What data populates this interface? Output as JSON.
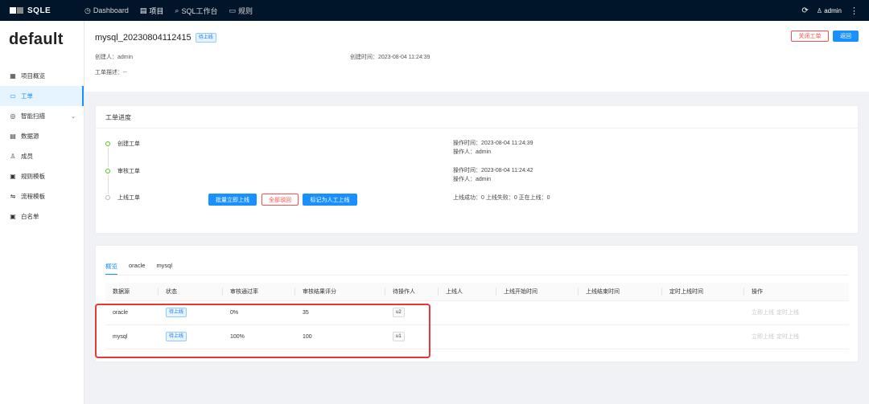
{
  "topbar": {
    "brand": "SQLE",
    "nav": [
      {
        "label": "Dashboard",
        "icon": "dashboard-icon",
        "glyph": "◷"
      },
      {
        "label": "项目",
        "icon": "project-icon",
        "glyph": "▤"
      },
      {
        "label": "SQL工作台",
        "icon": "search-icon",
        "glyph": "⌕"
      },
      {
        "label": "规则",
        "icon": "monitor-icon",
        "glyph": "▭"
      }
    ],
    "user": "admin"
  },
  "sidebar": {
    "project": "default",
    "items": [
      {
        "label": "项目概览",
        "icon": "overview-icon",
        "glyph": "▦"
      },
      {
        "label": "工单",
        "icon": "order-icon",
        "glyph": "▭"
      },
      {
        "label": "智能扫描",
        "icon": "scan-icon",
        "glyph": "◎"
      },
      {
        "label": "数据源",
        "icon": "database-icon",
        "glyph": "▤"
      },
      {
        "label": "成员",
        "icon": "user-icon",
        "glyph": "♙"
      },
      {
        "label": "规则模板",
        "icon": "rule-template-icon",
        "glyph": "▣"
      },
      {
        "label": "流程模板",
        "icon": "process-template-icon",
        "glyph": "⇋"
      },
      {
        "label": "白名单",
        "icon": "whitelist-icon",
        "glyph": "▣"
      }
    ]
  },
  "order": {
    "title": "mysql_20230804112415",
    "status": "待上线",
    "creator_label": "创建人：admin",
    "created_at_label": "创建时间：2023-08-04 11:24:39",
    "desc_label": "工单描述：--",
    "close_btn": "关闭工单",
    "back_btn": "返回"
  },
  "progress": {
    "title": "工单进度",
    "steps": [
      {
        "name": "创建工单",
        "info": [
          "操作时间：2023-08-04 11:24:39",
          "操作人：admin"
        ]
      },
      {
        "name": "审核工单",
        "info": [
          "操作时间：2023-08-04 11:24:42",
          "操作人：admin"
        ]
      },
      {
        "name": "上线工单",
        "info": [
          "上线成功：0 上线失败：0 正在上线：0"
        ]
      }
    ],
    "buttons": {
      "batch": "批量立即上线",
      "reject": "全部驳回",
      "manual": "标记为人工上线"
    }
  },
  "detail": {
    "tabs": [
      "概览",
      "oracle",
      "mysql"
    ],
    "columns": [
      "数据源",
      "状态",
      "审核通过率",
      "审核结果评分",
      "待操作人",
      "上线人",
      "上线开始时间",
      "上线结束时间",
      "定时上线时间",
      "操作"
    ],
    "rows": [
      {
        "datasource": "oracle",
        "status": "待上线",
        "pass_rate": "0%",
        "score": "35",
        "operator": "u2",
        "deployer": "",
        "start": "",
        "end": "",
        "scheduled": ""
      },
      {
        "datasource": "mysql",
        "status": "待上线",
        "pass_rate": "100%",
        "score": "100",
        "operator": "u1",
        "deployer": "",
        "start": "",
        "end": "",
        "scheduled": ""
      }
    ],
    "actions": [
      "立即上线",
      "定时上线"
    ]
  }
}
